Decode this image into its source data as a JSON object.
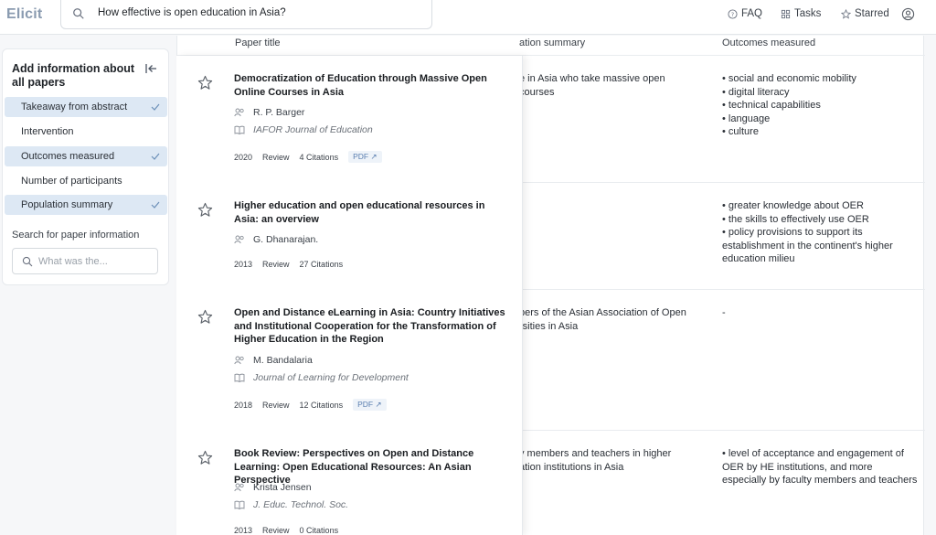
{
  "app": {
    "logo": "Elicit",
    "search_query": "How effective is open education in Asia?",
    "nav": [
      {
        "label": "FAQ",
        "icon": "help-circle-icon"
      },
      {
        "label": "Tasks",
        "icon": "grid-icon"
      },
      {
        "label": "Starred",
        "icon": "star-icon"
      }
    ],
    "account_icon": "user-circle-icon"
  },
  "sidebar": {
    "title": "Add information about all papers",
    "columns": [
      {
        "label": "Takeaway from abstract",
        "selected": true
      },
      {
        "label": "Intervention",
        "selected": false
      },
      {
        "label": "Outcomes measured",
        "selected": true
      },
      {
        "label": "Number of participants",
        "selected": false
      },
      {
        "label": "Population summary",
        "selected": true
      }
    ],
    "search_label": "Search for paper information",
    "search_placeholder": "What was the..."
  },
  "table": {
    "headers": {
      "paper_title": "Paper title",
      "population_summary": "ation summary",
      "outcomes_measured": "Outcomes measured"
    },
    "rows": [
      {
        "title": "Democratization of Education through Massive Open Online Courses in Asia",
        "author": "R. P. Barger",
        "journal": "IAFOR Journal of Education",
        "year": "2020",
        "type": "Review",
        "citations": "4 Citations",
        "pdf": "PDF ↗",
        "population": "e in Asia who take massive open courses",
        "outcomes": [
          "social and economic mobility",
          "digital literacy",
          "technical capabilities",
          "language",
          "culture"
        ]
      },
      {
        "title": "Higher education and open educational resources in Asia: an overview",
        "author": "G. Dhanarajan.",
        "journal": "",
        "year": "2013",
        "type": "Review",
        "citations": "27 Citations",
        "pdf": "",
        "population": "",
        "outcomes": [
          "greater knowledge about OER",
          "the skills to effectively use OER",
          "policy provisions to support its establishment in the continent's higher education milieu"
        ]
      },
      {
        "title": "Open and Distance eLearning in Asia: Country Initiatives and Institutional Cooperation for the Transformation of Higher Education in the Region",
        "author": "M. Bandalaria",
        "journal": "Journal of Learning for Development",
        "year": "2018",
        "type": "Review",
        "citations": "12 Citations",
        "pdf": "PDF ↗",
        "population": "bers of the Asian Association of Open rsities in Asia",
        "outcomes_text": "-"
      },
      {
        "title": "Book Review: Perspectives on Open and Distance Learning: Open Educational Resources: An Asian Perspective",
        "author": "Krista Jensen",
        "journal": "J. Educ. Technol. Soc.",
        "year": "2013",
        "type": "Review",
        "citations": "0 Citations",
        "pdf": "",
        "population": "y members and teachers in higher ation institutions in Asia",
        "outcomes": [
          "level of acceptance and engagement of OER by HE institutions, and more especially by faculty members and teachers"
        ]
      }
    ]
  }
}
